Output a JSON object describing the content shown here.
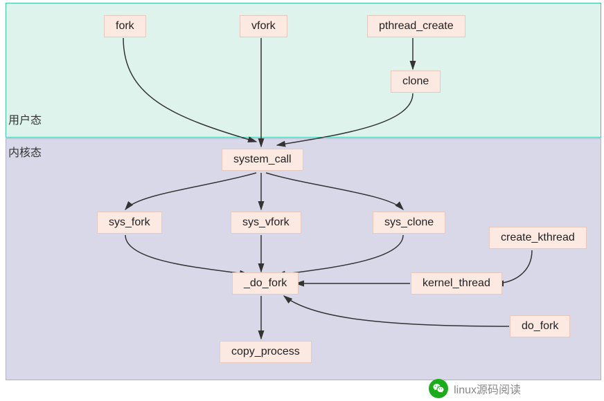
{
  "regions": {
    "user_space": "用户态",
    "kernel_space": "内核态"
  },
  "nodes": {
    "fork": "fork",
    "vfork": "vfork",
    "pthread_create": "pthread_create",
    "clone": "clone",
    "system_call": "system_call",
    "sys_fork": "sys_fork",
    "sys_vfork": "sys_vfork",
    "sys_clone": "sys_clone",
    "create_kthread": "create_kthread",
    "do_fork_underscore": "_do_fork",
    "kernel_thread": "kernel_thread",
    "do_fork": "do_fork",
    "copy_process": "copy_process"
  },
  "footer": {
    "text": "linux源码阅读"
  },
  "chart_data": {
    "type": "diagram",
    "title": "",
    "edges": [
      {
        "from": "fork",
        "to": "system_call"
      },
      {
        "from": "vfork",
        "to": "system_call"
      },
      {
        "from": "pthread_create",
        "to": "clone"
      },
      {
        "from": "clone",
        "to": "system_call"
      },
      {
        "from": "system_call",
        "to": "sys_fork"
      },
      {
        "from": "system_call",
        "to": "sys_vfork"
      },
      {
        "from": "system_call",
        "to": "sys_clone"
      },
      {
        "from": "sys_fork",
        "to": "_do_fork"
      },
      {
        "from": "sys_vfork",
        "to": "_do_fork"
      },
      {
        "from": "sys_clone",
        "to": "_do_fork"
      },
      {
        "from": "create_kthread",
        "to": "kernel_thread"
      },
      {
        "from": "kernel_thread",
        "to": "_do_fork"
      },
      {
        "from": "do_fork",
        "to": "_do_fork"
      },
      {
        "from": "_do_fork",
        "to": "copy_process"
      }
    ]
  }
}
